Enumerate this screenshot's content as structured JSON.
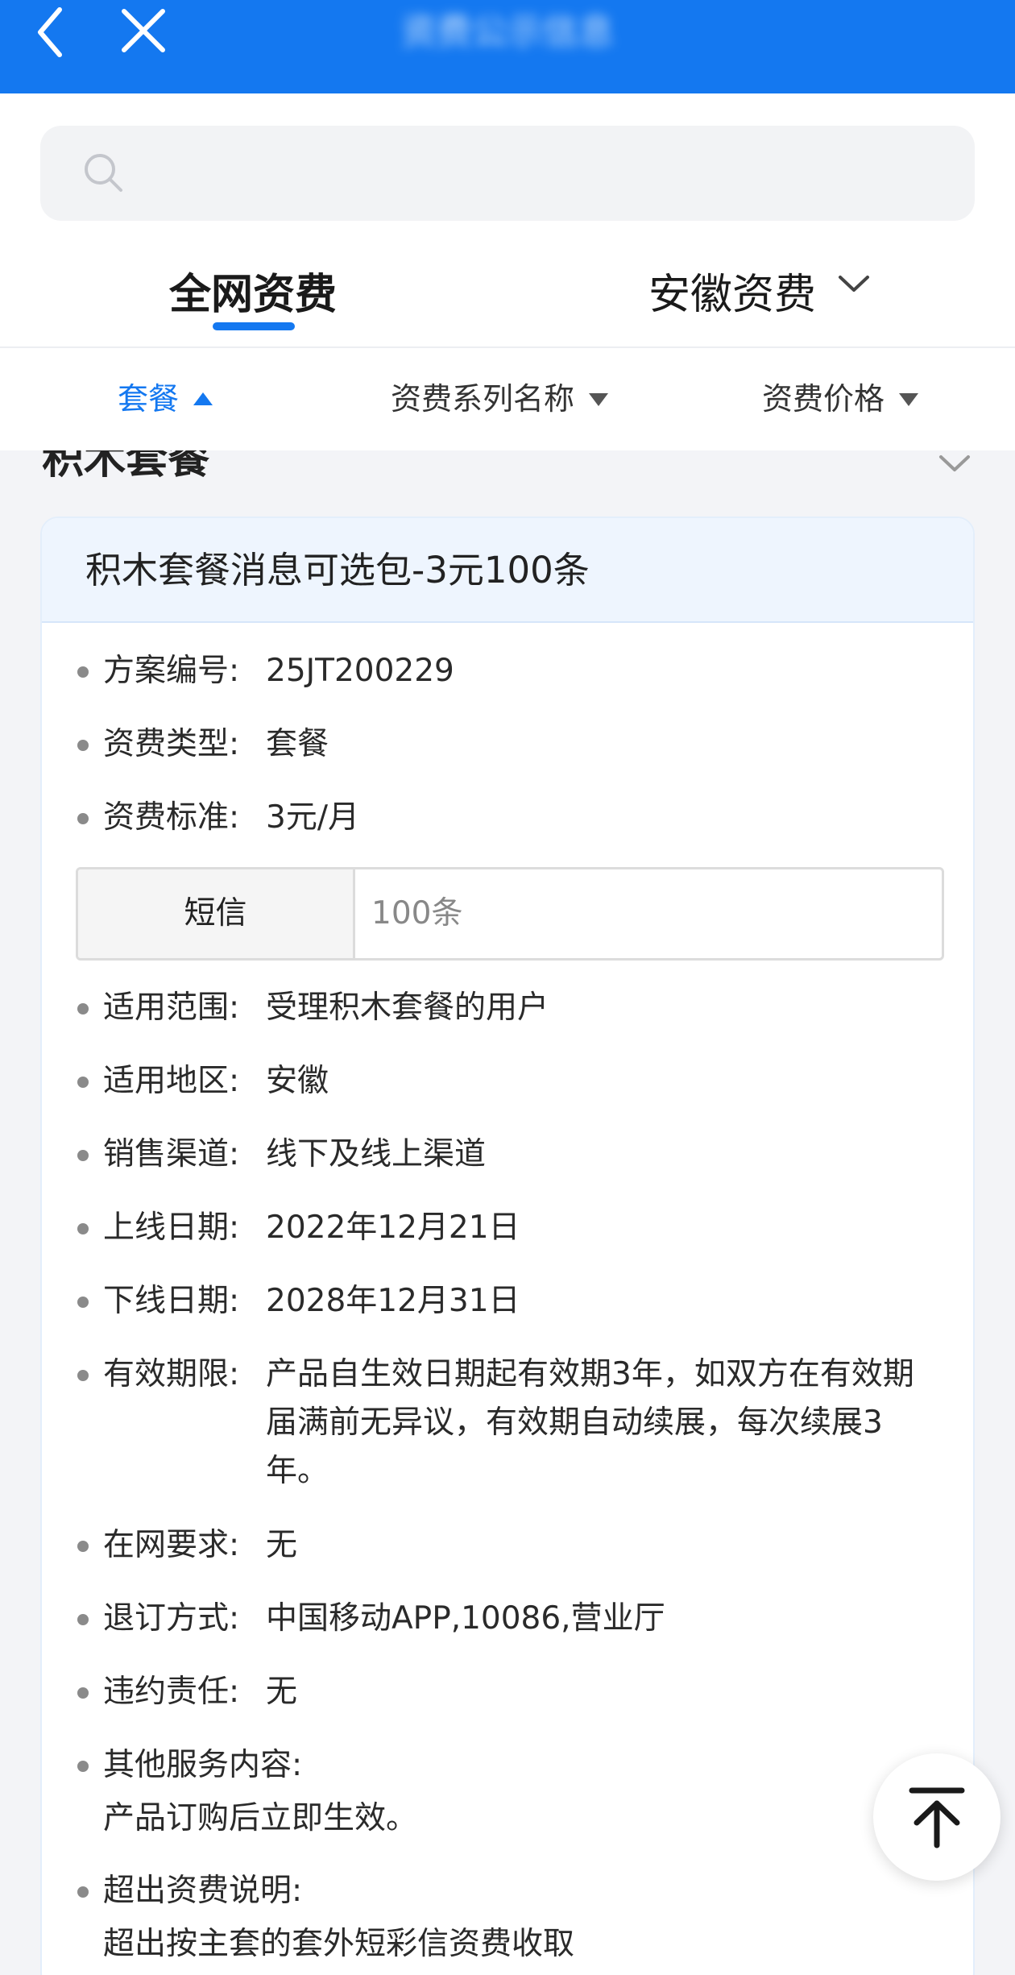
{
  "header": {
    "title": "资费公示信息",
    "icons": [
      "back-icon",
      "close-icon"
    ],
    "bg_color": "#1478f0"
  },
  "search": {
    "placeholder": "",
    "value": "",
    "icon": "search-icon"
  },
  "tabs": [
    {
      "label": "全网资费",
      "active": true
    },
    {
      "label": "安徽资费",
      "active": false,
      "icon": "chevron-down-icon"
    }
  ],
  "filters": [
    {
      "label": "套餐",
      "active": true,
      "icon": "triangle-up-icon"
    },
    {
      "label": "资费系列名称",
      "active": false,
      "icon": "triangle-down-icon"
    },
    {
      "label": "资费价格",
      "active": false,
      "icon": "triangle-down-icon"
    }
  ],
  "group": {
    "title": "积木套餐",
    "icon": "chevron-down-icon"
  },
  "card": {
    "title": "积木套餐消息可选包-3元100条",
    "fields": [
      {
        "label": "方案编号:",
        "value": "25JT200229"
      },
      {
        "label": "资费类型:",
        "value": "套餐"
      },
      {
        "label": "资费标准:",
        "value": "3元/月"
      },
      {
        "label": "适用范围:",
        "value": "受理积木套餐的用户"
      },
      {
        "label": "适用地区:",
        "value": "安徽"
      },
      {
        "label": "销售渠道:",
        "value": "线下及线上渠道"
      },
      {
        "label": "上线日期:",
        "value": "2022年12月21日"
      },
      {
        "label": "下线日期:",
        "value": "2028年12月31日"
      },
      {
        "label": "有效期限:",
        "value": "产品自生效日期起有效期3年，如双方在有效期届满前无异议，有效期自动续展，每次续展3年。"
      },
      {
        "label": "在网要求:",
        "value": "无"
      },
      {
        "label": "退订方式:",
        "value": "中国移动APP,10086,营业厅"
      },
      {
        "label": "违约责任:",
        "value": "无"
      },
      {
        "label": "其他服务内容:",
        "value": "产品订购后立即生效。"
      },
      {
        "label": "超出资费说明:",
        "value": "超出按主套的套外短彩信资费收取"
      }
    ],
    "sms_table": {
      "name": "短信",
      "amount": "100条"
    }
  },
  "back_to_top": {
    "icon": "arrow-up-to-top-icon"
  },
  "colors": {
    "accent": "#1478f0",
    "card_header": "#eef5fe",
    "page_bg": "#f3f4f7"
  }
}
